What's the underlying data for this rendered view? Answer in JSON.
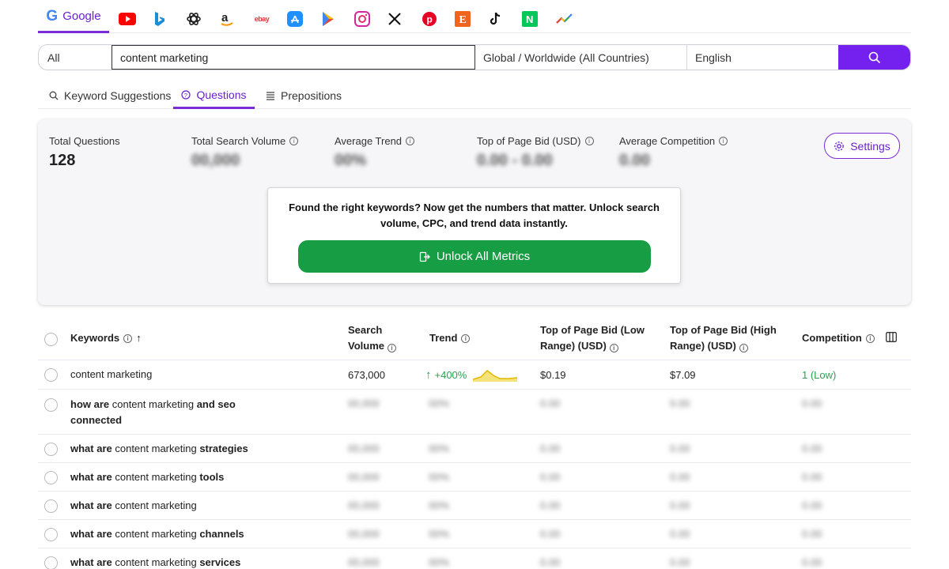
{
  "sources": {
    "active": "Google",
    "icons": [
      "youtube-icon",
      "bing-icon",
      "chatgpt-icon",
      "amazon-icon",
      "ebay-icon",
      "app-store-icon",
      "play-store-icon",
      "instagram-icon",
      "x-icon",
      "pinterest-icon",
      "etsy-icon",
      "tiktok-icon",
      "naver-icon",
      "trends-icon"
    ],
    "ebay_label": "ebay"
  },
  "search": {
    "scope": "All",
    "query": "content marketing",
    "location": "Global / Worldwide (All Countries)",
    "language": "English"
  },
  "tabs": [
    "Keyword Suggestions",
    "Questions",
    "Prepositions"
  ],
  "active_tab": "Questions",
  "metrics": {
    "total_questions_label": "Total Questions",
    "total_questions_value": "128",
    "total_volume_label": "Total Search Volume",
    "total_volume_value": "00,000",
    "avg_trend_label": "Average Trend",
    "avg_trend_value": "00%",
    "bid_label": "Top of Page Bid (USD)",
    "bid_value": "0.00 - 0.00",
    "competition_label": "Average Competition",
    "competition_value": "0.00",
    "settings_label": "Settings"
  },
  "unlock": {
    "message": "Found the right keywords? Now get the numbers that matter. Unlock search volume, CPC, and trend data instantly.",
    "button": "Unlock All Metrics"
  },
  "table": {
    "headers": {
      "keywords": "Keywords",
      "sort_arrow": "↑",
      "volume_1": "Search",
      "volume_2": "Volume",
      "trend": "Trend",
      "bid_low_1": "Top of Page Bid (Low",
      "bid_low_2": "Range) (USD)",
      "bid_high_1": "Top of Page Bid (High",
      "bid_high_2": "Range) (USD)",
      "competition": "Competition"
    },
    "first_row": {
      "keyword": "content marketing",
      "volume": "673,000",
      "trend": "+400%",
      "bid_low": "$0.19",
      "bid_high": "$7.09",
      "competition": "1 (Low)"
    },
    "rows": [
      {
        "pre": "how are",
        "mid": " content marketing ",
        "post": "and seo connected"
      },
      {
        "pre": "what are",
        "mid": " content marketing ",
        "post": "strategies"
      },
      {
        "pre": "what are",
        "mid": " content marketing ",
        "post": "tools"
      },
      {
        "pre": "what are",
        "mid": " content marketing",
        "post": ""
      },
      {
        "pre": "what are",
        "mid": " content marketing ",
        "post": "channels"
      },
      {
        "pre": "what are",
        "mid": " content marketing ",
        "post": "services"
      }
    ],
    "blurred": {
      "volume": "00,000",
      "trend": "00%",
      "bid": "0.00",
      "competition": "0.00"
    }
  },
  "colors": {
    "accent": "#7421f0",
    "unlock_green": "#179e44",
    "positive_green": "#2aa152"
  }
}
